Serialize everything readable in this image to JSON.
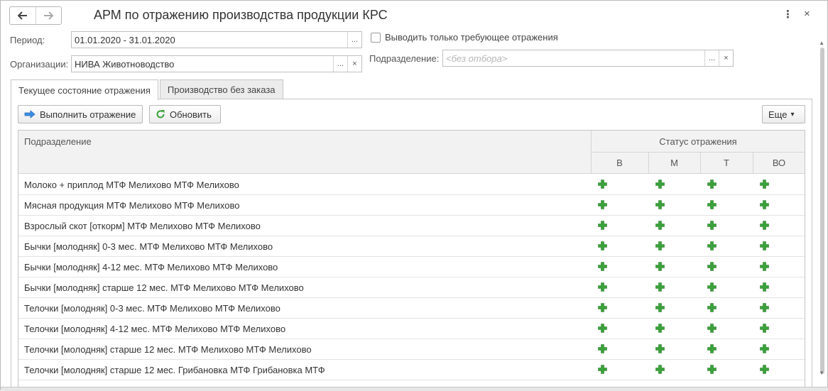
{
  "window": {
    "title": "АРМ по отражению производства продукции КРС",
    "more_label": "⋮",
    "close_label": "×"
  },
  "nav": {
    "back": "🡐",
    "forward": "🡒"
  },
  "form": {
    "period_label": "Период:",
    "period_value": "01.01.2020 - 31.01.2020",
    "org_label": "Организации:",
    "org_value": "НИВА Животноводство",
    "only_required_label": "Выводить только требующее отражения",
    "only_required_checked": false,
    "division_label": "Подразделение:",
    "division_placeholder": "<без отбора>",
    "select_btn": "...",
    "clear_btn": "×"
  },
  "tabs": [
    {
      "label": "Текущее состояние отражения",
      "active": true
    },
    {
      "label": "Производство без заказа",
      "active": false
    }
  ],
  "toolbar": {
    "execute_label": "Выполнить отражение",
    "refresh_label": "Обновить",
    "more_label": "Еще",
    "more_arrow": "▾"
  },
  "table": {
    "col_division": "Подразделение",
    "status_group": "Статус отражения",
    "status_cols": [
      "В",
      "М",
      "Т",
      "ВО"
    ],
    "status_icon_color": "#3aa23a",
    "rows": [
      {
        "name": "Молоко + приплод МТФ Мелихово МТФ Мелихово"
      },
      {
        "name": "Мясная продукция МТФ Мелихово МТФ Мелихово"
      },
      {
        "name": "Взрослый скот [откорм] МТФ Мелихово МТФ Мелихово"
      },
      {
        "name": "Бычки [молодняк] 0-3 мес. МТФ Мелихово МТФ Мелихово"
      },
      {
        "name": "Бычки [молодняк] 4-12 мес. МТФ Мелихово МТФ Мелихово"
      },
      {
        "name": "Бычки [молодняк] старше 12 мес. МТФ Мелихово МТФ Мелихово"
      },
      {
        "name": "Телочки [молодняк] 0-3 мес. МТФ Мелихово МТФ Мелихово"
      },
      {
        "name": "Телочки [молодняк] 4-12 мес. МТФ Мелихово МТФ Мелихово"
      },
      {
        "name": "Телочки [молодняк] старше 12 мес. МТФ Мелихово МТФ Мелихово"
      },
      {
        "name": "Телочки [молодняк] старше 12 мес. Грибановка МТФ Грибановка МТФ"
      }
    ]
  }
}
